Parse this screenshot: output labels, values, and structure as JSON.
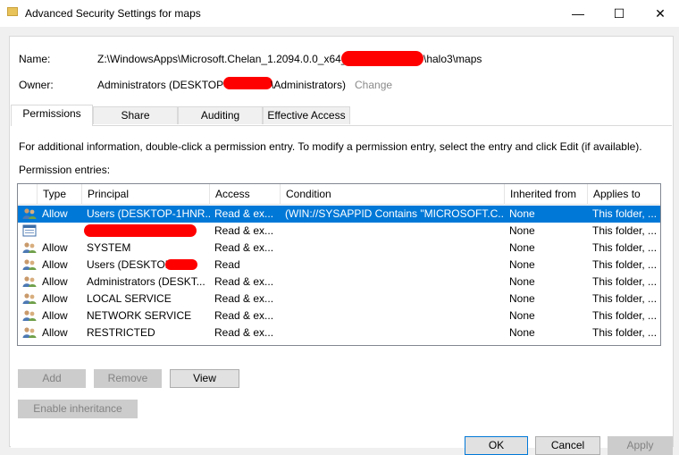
{
  "window": {
    "title": "Advanced Security Settings for maps",
    "minimize": "—",
    "maximize": "☐",
    "close": "✕"
  },
  "name_label": "Name:",
  "name_value_start": "Z:\\WindowsApps\\Microsoft.Chelan_1.2094.0.0_x64__",
  "name_value_end": "\\halo3\\maps",
  "owner_label": "Owner:",
  "owner_value_start": "Administrators (DESKTOP-",
  "owner_value_end": "\\Administrators)",
  "owner_change": "Change",
  "tabs": [
    "Permissions",
    "Share",
    "Auditing",
    "Effective Access"
  ],
  "info_text": "For additional information, double-click a permission entry. To modify a permission entry, select the entry and click Edit (if available).",
  "entries_label": "Permission entries:",
  "columns": [
    "Type",
    "Principal",
    "Access",
    "Condition",
    "Inherited from",
    "Applies to"
  ],
  "rows": [
    {
      "type": "Allow",
      "principal": "Users (DESKTOP-1HNR...",
      "access": "Read & ex...",
      "condition": "(WIN://SYSAPPID Contains \"MICROSOFT.C...",
      "inherited": "None",
      "applies": "This folder, ..."
    },
    {
      "type": "",
      "principal": "",
      "access": "Read & ex...",
      "condition": "",
      "inherited": "None",
      "applies": "This folder, ..."
    },
    {
      "type": "Allow",
      "principal": "SYSTEM",
      "access": "Read & ex...",
      "condition": "",
      "inherited": "None",
      "applies": "This folder, ..."
    },
    {
      "type": "Allow",
      "principal": "Users (DESKTOP-",
      "access": "Read",
      "condition": "",
      "inherited": "None",
      "applies": "This folder, ..."
    },
    {
      "type": "Allow",
      "principal": "Administrators (DESKT...",
      "access": "Read & ex...",
      "condition": "",
      "inherited": "None",
      "applies": "This folder, ..."
    },
    {
      "type": "Allow",
      "principal": "LOCAL SERVICE",
      "access": "Read & ex...",
      "condition": "",
      "inherited": "None",
      "applies": "This folder, ..."
    },
    {
      "type": "Allow",
      "principal": "NETWORK SERVICE",
      "access": "Read & ex...",
      "condition": "",
      "inherited": "None",
      "applies": "This folder, ..."
    },
    {
      "type": "Allow",
      "principal": "RESTRICTED",
      "access": "Read & ex...",
      "condition": "",
      "inherited": "None",
      "applies": "This folder, ..."
    }
  ],
  "buttons": {
    "add": "Add",
    "remove": "Remove",
    "view": "View",
    "enable_inheritance": "Enable inheritance",
    "ok": "OK",
    "cancel": "Cancel",
    "apply": "Apply"
  },
  "colors": {
    "selection": "#0078d7",
    "redaction": "#ff0000"
  }
}
